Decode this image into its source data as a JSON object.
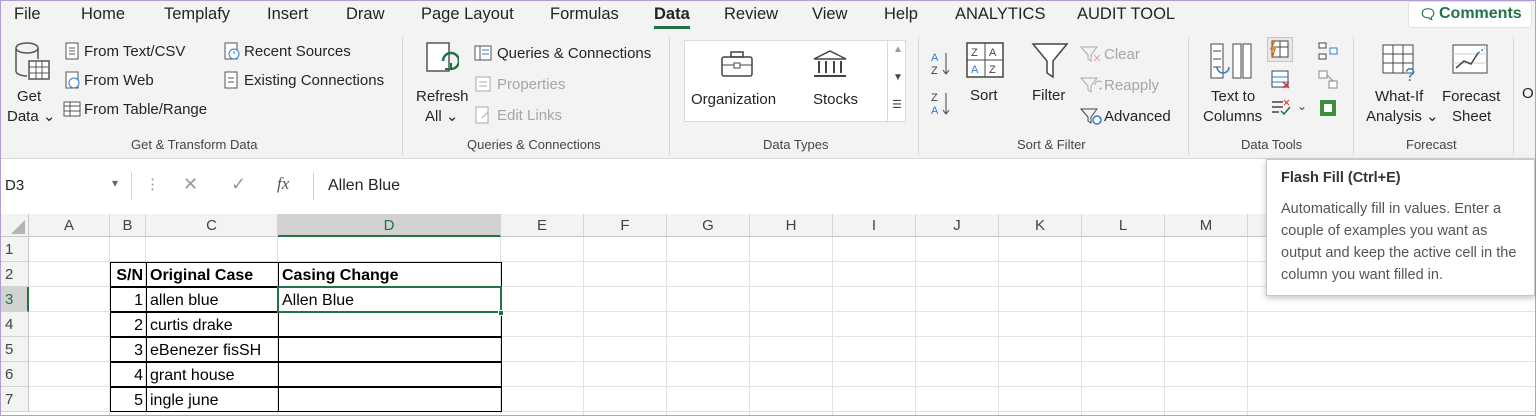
{
  "menu": {
    "items": [
      "File",
      "Home",
      "Templafy",
      "Insert",
      "Draw",
      "Page Layout",
      "Formulas",
      "Data",
      "Review",
      "View",
      "Help",
      "ANALYTICS",
      "AUDIT TOOL"
    ],
    "active": "Data",
    "comments_label": "Comments"
  },
  "ribbon": {
    "get_data": {
      "line1": "Get",
      "line2": "Data ⌄"
    },
    "from_text_csv": "From Text/CSV",
    "from_web": "From Web",
    "from_table_range": "From Table/Range",
    "recent_sources": "Recent Sources",
    "existing_connections": "Existing Connections",
    "group_get_transform": "Get & Transform Data",
    "refresh": {
      "line1": "Refresh",
      "line2": "All ⌄"
    },
    "queries_connections": "Queries & Connections",
    "properties": "Properties",
    "edit_links": "Edit Links",
    "group_queries": "Queries & Connections",
    "organization": "Organization",
    "stocks": "Stocks",
    "group_data_types": "Data Types",
    "sort": "Sort",
    "filter": "Filter",
    "clear": "Clear",
    "reapply": "Reapply",
    "advanced": "Advanced",
    "group_sort_filter": "Sort & Filter",
    "text_to_columns": {
      "line1": "Text to",
      "line2": "Columns"
    },
    "group_data_tools": "Data Tools",
    "what_if": {
      "line1": "What-If",
      "line2": "Analysis ⌄"
    },
    "forecast_sheet": {
      "line1": "Forecast",
      "line2": "Sheet"
    },
    "group_forecast": "Forecast",
    "outline_partial": "O"
  },
  "formula_bar": {
    "name_box": "D3",
    "fx": "fx",
    "content": "Allen Blue"
  },
  "columns": [
    "A",
    "B",
    "C",
    "D",
    "E",
    "F",
    "G",
    "H",
    "I",
    "J",
    "K",
    "L",
    "M"
  ],
  "rows": [
    "1",
    "2",
    "3",
    "4",
    "5",
    "6",
    "7"
  ],
  "selected": {
    "column": "D",
    "row": "3"
  },
  "table": {
    "headers": [
      "S/N",
      "Original Case",
      "Casing Change"
    ],
    "rows": [
      {
        "sn": "1",
        "original": "allen blue",
        "changed": "Allen Blue"
      },
      {
        "sn": "2",
        "original": "curtis drake",
        "changed": ""
      },
      {
        "sn": "3",
        "original": "eBenezer fisSH",
        "changed": ""
      },
      {
        "sn": "4",
        "original": "grant house",
        "changed": ""
      },
      {
        "sn": "5",
        "original": "ingle june",
        "changed": ""
      }
    ]
  },
  "tooltip": {
    "title": "Flash Fill (Ctrl+E)",
    "body": "Automatically fill in values. Enter a couple of examples you want as output and keep the active cell in the column you want filled in."
  },
  "colors": {
    "accent": "#217346",
    "ribbon_bg": "#f3f3f3"
  }
}
